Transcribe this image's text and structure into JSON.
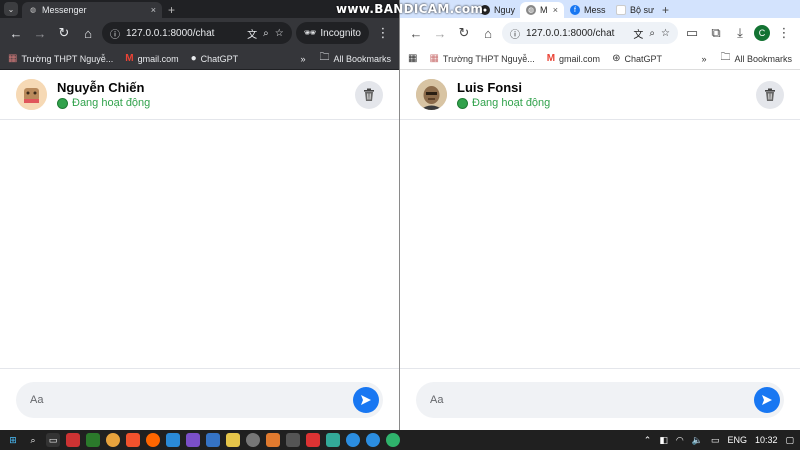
{
  "watermark": {
    "text": "www.BANDICAM.com"
  },
  "left_window": {
    "tabs": [
      {
        "title": "Messenger",
        "close": "×"
      }
    ],
    "new_tab": "+",
    "address": "127.0.0.1:8000/chat",
    "incognito_label": "Incognito",
    "bookmarks": [
      {
        "label": "Trường THPT Nguyễ...",
        "icon": "school-icon"
      },
      {
        "label": "gmail.com",
        "icon": "gmail-icon"
      },
      {
        "label": "ChatGPT",
        "icon": "chatgpt-icon"
      }
    ],
    "more_bookmarks": "»",
    "all_bookmarks": "All Bookmarks",
    "chat": {
      "name": "Nguyễn Chiến",
      "status": "Đang hoạt động",
      "placeholder": "Aa"
    }
  },
  "right_window": {
    "tabs": [
      {
        "title": "Nguy",
        "icon": "github-icon"
      },
      {
        "title": "M",
        "icon": "chrome-icon",
        "close": "×"
      },
      {
        "title": "Mess",
        "icon": "facebook-icon"
      },
      {
        "title": "Bộ sư",
        "icon": "page-icon"
      }
    ],
    "new_tab": "+",
    "address": "127.0.0.1:8000/chat",
    "profile_initial": "C",
    "bookmarks": [
      {
        "label": "Trường THPT Nguyễ...",
        "icon": "school-icon"
      },
      {
        "label": "gmail.com",
        "icon": "gmail-icon"
      },
      {
        "label": "ChatGPT",
        "icon": "chatgpt-icon"
      }
    ],
    "more_bookmarks": "»",
    "all_bookmarks": "All Bookmarks",
    "chat": {
      "name": "Luis Fonsi",
      "status": "Đang hoạt động",
      "placeholder": "Aa"
    }
  },
  "taskbar": {
    "language": "ENG",
    "time": "10:32"
  },
  "colors": {
    "status_green": "#31a24c",
    "send_blue": "#1877f2",
    "incognito_dark": "#35363a"
  }
}
